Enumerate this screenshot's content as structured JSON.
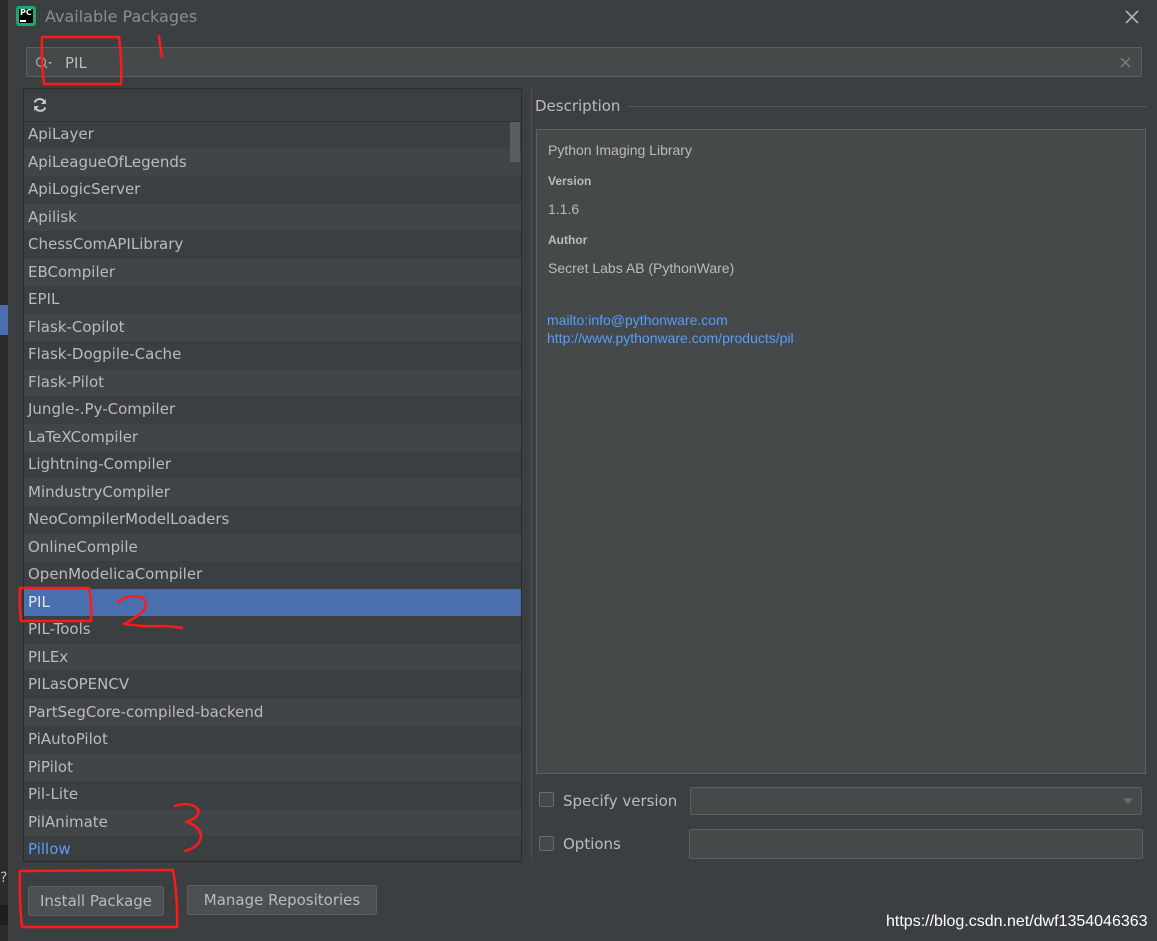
{
  "window": {
    "title": "Available Packages"
  },
  "app_icon": {
    "text": "PC"
  },
  "search": {
    "value": "PIL"
  },
  "packages": [
    {
      "name": "ApiLayer"
    },
    {
      "name": "ApiLeagueOfLegends"
    },
    {
      "name": "ApiLogicServer"
    },
    {
      "name": "Apilisk"
    },
    {
      "name": "ChessComAPILibrary"
    },
    {
      "name": "EBCompiler"
    },
    {
      "name": "EPIL"
    },
    {
      "name": "Flask-Copilot"
    },
    {
      "name": "Flask-Dogpile-Cache"
    },
    {
      "name": "Flask-Pilot"
    },
    {
      "name": "Jungle-.Py-Compiler"
    },
    {
      "name": "LaTeXCompiler"
    },
    {
      "name": "Lightning-Compiler"
    },
    {
      "name": "MindustryCompiler"
    },
    {
      "name": "NeoCompilerModelLoaders"
    },
    {
      "name": "OnlineCompile"
    },
    {
      "name": "OpenModelicaCompiler"
    },
    {
      "name": "PIL",
      "selected": true
    },
    {
      "name": "PIL-Tools"
    },
    {
      "name": "PILEx"
    },
    {
      "name": "PILasOPENCV"
    },
    {
      "name": "PartSegCore-compiled-backend"
    },
    {
      "name": "PiAutoPilot"
    },
    {
      "name": "PiPilot"
    },
    {
      "name": "Pil-Lite"
    },
    {
      "name": "PilAnimate"
    },
    {
      "name": "Pillow",
      "installed": true
    }
  ],
  "description": {
    "header": "Description",
    "summary": "Python Imaging Library",
    "version_label": "Version",
    "version": "1.1.6",
    "author_label": "Author",
    "author": "Secret Labs AB (PythonWare)",
    "links": [
      "mailto:info@pythonware.com",
      "http://www.pythonware.com/products/pil"
    ]
  },
  "options": {
    "specify_version_label": "Specify version",
    "specify_version_checked": false,
    "options_label": "Options",
    "options_checked": false,
    "options_value": ""
  },
  "buttons": {
    "install": "Install Package",
    "manage": "Manage Repositories"
  },
  "annotations": [
    "1",
    "2",
    "3"
  ],
  "watermark": "https://blog.csdn.net/dwf1354046363",
  "colors": {
    "background": "#3c3f41",
    "selection": "#4b6eaf",
    "link": "#589df6",
    "annotation": "#ff1a1a"
  }
}
